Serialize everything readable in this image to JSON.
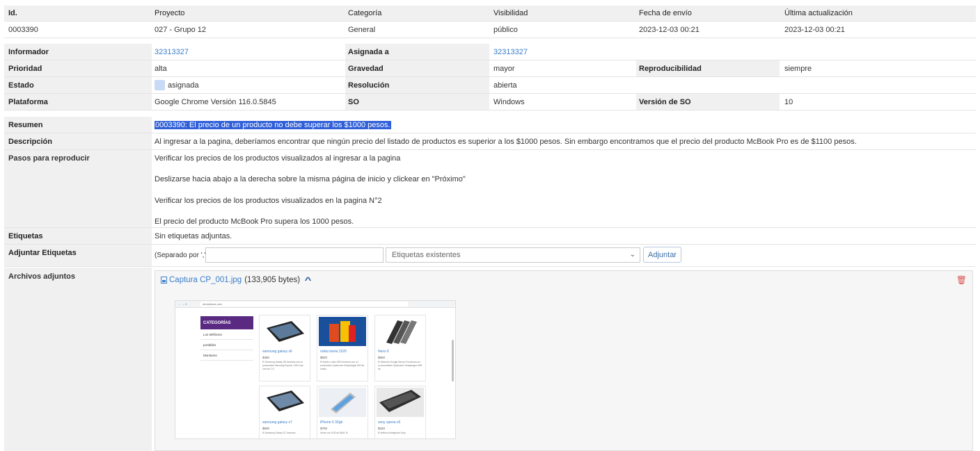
{
  "header": {
    "id_label": "Id.",
    "project_label": "Proyecto",
    "category_label": "Categoría",
    "visibility_label": "Visibilidad",
    "submitted_label": "Fecha de envío",
    "updated_label": "Última actualización"
  },
  "summary_row": {
    "id": "0003390",
    "project": "027 - Grupo 12",
    "category": "General",
    "visibility": "público",
    "submitted": "2023-12-03 00:21",
    "updated": "2023-12-03 00:21"
  },
  "details": {
    "reporter_label": "Informador",
    "reporter": "32313327",
    "assigned_label": "Asignada a",
    "assigned": "32313327",
    "priority_label": "Prioridad",
    "priority": "alta",
    "severity_label": "Gravedad",
    "severity": "mayor",
    "reproducibility_label": "Reproducibilidad",
    "reproducibility": "siempre",
    "status_label": "Estado",
    "status": "asignada",
    "status_color": "#c8daf5",
    "resolution_label": "Resolución",
    "resolution": "abierta",
    "platform_label": "Plataforma",
    "platform": "Google Chrome Versión 116.0.5845",
    "os_label": "SO",
    "os": "Windows",
    "os_version_label": "Versión de SO",
    "os_version": "10"
  },
  "issue": {
    "summary_label": "Resumen",
    "summary": "0003390: El precio de un producto no debe superar los $1000 pesos.",
    "description_label": "Descripción",
    "description": "Al ingresar a la pagina, deberíamos encontrar que ningún precio del listado de productos es superior a los $1000 pesos. Sin embargo encontramos que el precio del producto McBook Pro es de $1100 pesos.",
    "steps_label": "Pasos para reproducir",
    "steps": [
      "Verificar los precios de los productos visualizados al ingresar a la pagina",
      "Deslizarse hacia abajo a la derecha sobre la misma página de inicio y clickear en \"Próximo\"",
      "Verificar los precios de los productos visualizados en la pagina N°2",
      "El precio del producto McBook Pro supera los 1000 pesos."
    ],
    "tags_label": "Etiquetas",
    "tags": "Sin etiquetas adjuntas.",
    "attach_tags_label": "Adjuntar Etiquetas",
    "tags_hint": "(Separado por ',')",
    "tags_input_value": "",
    "existing_tags_option": "Etiquetas existentes",
    "attach_button": "Adjuntar",
    "files_label": "Archivos adjuntos",
    "file_name": "Captura CP_001.jpg",
    "file_size": "(133,905 bytes)"
  },
  "screenshot_preview": {
    "url": "demoblaze.com",
    "categories_title": "CATEGORÍAS",
    "categories": [
      "Los teléfonos",
      "portátiles",
      "Monitores"
    ],
    "products": [
      {
        "name": "samsung galaxy s6",
        "price": "$360",
        "desc": "El Samsung Galaxy S6 funciona con un procesador Samsung Exynos 7420 octa core de 1.5"
      },
      {
        "name": "nokia lumia 1520",
        "price": "$820",
        "desc": "El Nokia Lumia 1520 funciona con un procesador Qualcomm Snapdragon 800 de cuatro"
      },
      {
        "name": "Nexo 6",
        "price": "$650",
        "desc": "El Motorola Google Nexus 6 funciona con un procesador Qualcomm Snapdragon 805 de"
      },
      {
        "name": "samsung galaxy s7",
        "price": "$800",
        "desc": "El Samsung Galaxy S7 funciona"
      },
      {
        "name": "iPhone 6 32gb",
        "price": "$790",
        "desc": "Viene con 1GB de RAM. El"
      },
      {
        "name": "sony xperia z5",
        "price": "$320",
        "desc": "El teléfono inteligente Sony"
      }
    ]
  }
}
